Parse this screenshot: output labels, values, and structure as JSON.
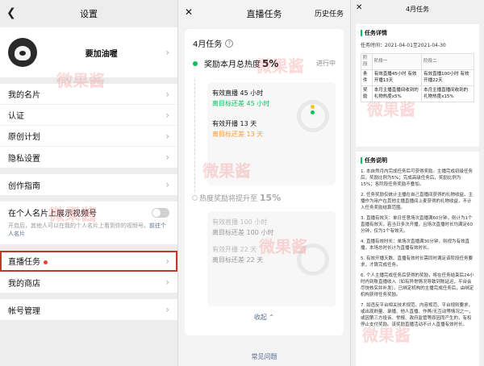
{
  "settings": {
    "title": "设置",
    "profile_name": "要加油喔",
    "items_a": [
      "我的名片",
      "认证",
      "原创计划",
      "隐私设置"
    ],
    "item_guide": "创作指南",
    "toggle_label": "在个人名片上展示视频号",
    "toggle_desc": "开启后，其他人可以在我的个人名片上看到你的视频号。",
    "toggle_link": "前往个人名片",
    "live_task": "直播任务",
    "my_shop": "我的商店",
    "account": "帐号管理"
  },
  "live": {
    "title": "直播任务",
    "history": "历史任务",
    "month": "4月任务",
    "reward1_label": "奖励本月总热度",
    "reward1_value": "5%",
    "status": "进行中",
    "task_a1": "有效直播 45 小时",
    "task_a1_status": "离目标还差 45 小时",
    "task_a2": "有效开播 13 天",
    "task_a2_status": "离目标还差 13 天",
    "reward2_label": "热度奖励将提升至",
    "reward2_value": "15%",
    "task_b1": "有效直播 100 小时",
    "task_b1_status": "离目标还差 100 小时",
    "task_b2": "有效开播 22 天",
    "task_b2_status": "离目标还差 22 天",
    "collapse": "收起",
    "faq": "常见问题"
  },
  "detail": {
    "title": "4月任务",
    "sec1": "任务详情",
    "period_label": "任务时间：",
    "period_value": "2021-04-01至2021-04-30",
    "table_head": [
      "阶段",
      "阶段一",
      "阶段二"
    ],
    "row1_label": "条件",
    "row1_a": "有效直播45小时 有效开播13天",
    "row1_b": "有效直播100小时 有效开播22天",
    "row2_label": "奖励",
    "row2_a": "本月主播直播间收到的礼物热度x5%",
    "row2_b": "本月主播直播间收到的礼物热度x15%",
    "sec2": "任务说明",
    "p1": "1. 本自然月内完成任务后可获得奖励。主播完成初级任务后，奖励比例为5%；完成高级任务后，奖励比例为15%；各阶段任务奖励不叠加。",
    "p2": "2. 任务奖励仅统计主播在自己直播间获得的礼物收益。主播作为用户在其他主播直播间上麦获得的礼物收益，不计入任务奖励结算范围。",
    "p3": "3. 直播有效天：单日任意场次直播满60分钟，则计为1个直播有效天。若当日多次开播，且场次直播时长均满足60分钟，仅为1个有效天。",
    "p4": "4. 直播有效时长：单场次直播满30分钟，则视为有效直播，本场总时长计为直播有效时长。",
    "p5": "5. 有效开播天数、直播有效时长需同时满足该阶段任务要求，才算完成任务。",
    "p6": "6. 个人主播完成任务后获得的奖励，将在任务结束后24小时内到账直播收入（如有异常情况导致到账延迟，平台会尽快核实并补发）。已绑定机构的主播完成任务后，由绑定机构获得任务奖励。",
    "p7": "7. 如违反平台相关技术规范、内容规范、平台规则要求，或出现刷量、录播、他人直播、作弊/无互动等情况之一，或因第三方投诉、举报、政府监管等原因而产生的，有权停止支付奖励。该奖励直播活动不计入直播有效时长。"
  },
  "watermark": "微果酱",
  "colors": {
    "accent_green": "#07c160",
    "warn_orange": "#fa9d3b",
    "link_blue": "#576b95",
    "highlight_red": "#c0392b"
  }
}
